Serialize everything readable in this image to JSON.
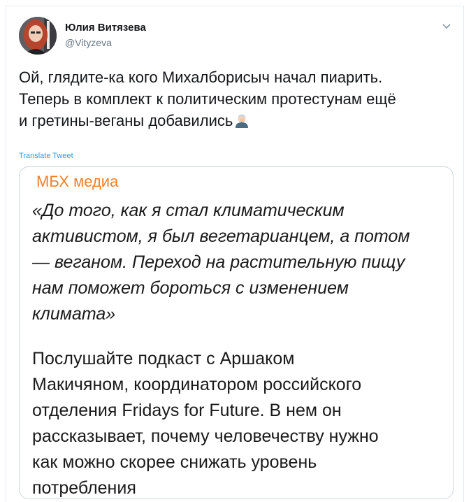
{
  "author": {
    "display_name": "Юлия Витязева",
    "handle": "@Vityzeva"
  },
  "tweet": {
    "text_lines": [
      "Ой, глядите-ка кого Михалборисыч начал пиарить.",
      "Теперь в комплект к политическим протестунам ещё",
      "и гретины-веганы добавились"
    ],
    "emoji": "man-facepalming-icon",
    "translate_label": "Translate Tweet"
  },
  "media": {
    "channel": "МБХ медиа",
    "quote_lines": [
      "«До того, как я стал климатическим",
      "активистом, я был вегетарианцем, а потом",
      "— веганом. Переход на растительную пищу",
      "нам поможет бороться с изменением",
      "климата»"
    ],
    "body_lines": [
      "Послушайте подкаст с Аршаком",
      "Макичяном, координатором российского",
      "отделения Fridays for Future. В нем он",
      "рассказывает, почему человечеству нужно",
      "как можно скорее снижать уровень",
      "потребления"
    ]
  },
  "colors": {
    "link": "#1da1f2",
    "channel_accent": "#f07f2a",
    "secondary_text": "#657786",
    "border": "#ccd6dd"
  }
}
